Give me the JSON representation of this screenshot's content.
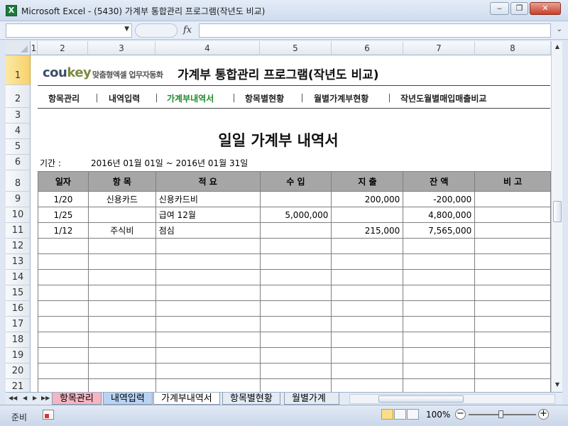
{
  "window": {
    "title": "Microsoft Excel - (5430) 가계부 통합관리 프로그램(작년도 비교)",
    "app_icon": "X",
    "minimize_icon": "minimize-icon",
    "restore_icon": "restore-icon",
    "close_icon": "close-icon"
  },
  "formula_bar": {
    "name_box": "",
    "fx_label": "fx",
    "formula": ""
  },
  "columns": [
    "1",
    "2",
    "3",
    "4",
    "5",
    "6",
    "7",
    "8"
  ],
  "rows": [
    "1",
    "2",
    "3",
    "4",
    "5",
    "6",
    "8",
    "9",
    "10",
    "11",
    "12",
    "13",
    "14",
    "15",
    "16",
    "17",
    "18",
    "19",
    "20",
    "21"
  ],
  "header": {
    "logo_main": "cou",
    "logo_key": "key",
    "logo_sub": "맞춤형엑셀 업무자동화",
    "app_title": "가계부 통합관리 프로그램(작년도 비교)"
  },
  "menu": {
    "items": [
      "항목관리",
      "내역입력",
      "가계부내역서",
      "항목별현황",
      "월별가계부현황",
      "작년도월별매입매출비교"
    ],
    "active": "가계부내역서"
  },
  "document": {
    "title": "일일 가계부 내역서",
    "period_label": "기간 :",
    "period_value": "2016년 01월 01일 ~ 2016년 01월 31일"
  },
  "table": {
    "headers": [
      "일자",
      "항 목",
      "적 요",
      "수 입",
      "지 출",
      "잔 액",
      "비 고"
    ],
    "rows": [
      [
        "1/20",
        "신용카드",
        "신용카드비",
        "",
        "200,000",
        "-200,000",
        ""
      ],
      [
        "1/25",
        "",
        "급여 12월",
        "5,000,000",
        "",
        "4,800,000",
        ""
      ],
      [
        "1/12",
        "주식비",
        "점심",
        "",
        "215,000",
        "7,565,000",
        ""
      ]
    ],
    "empty_rows": 10
  },
  "sheet_tabs": [
    "항목관리",
    "내역입력",
    "가계부내역서",
    "항목별현황",
    "월별가계"
  ],
  "active_sheet": "가계부내역서",
  "status": {
    "ready_text": "준비",
    "zoom": "100%",
    "zoom_minus": "−",
    "zoom_plus": "+",
    "zoom_level": 1.0
  }
}
